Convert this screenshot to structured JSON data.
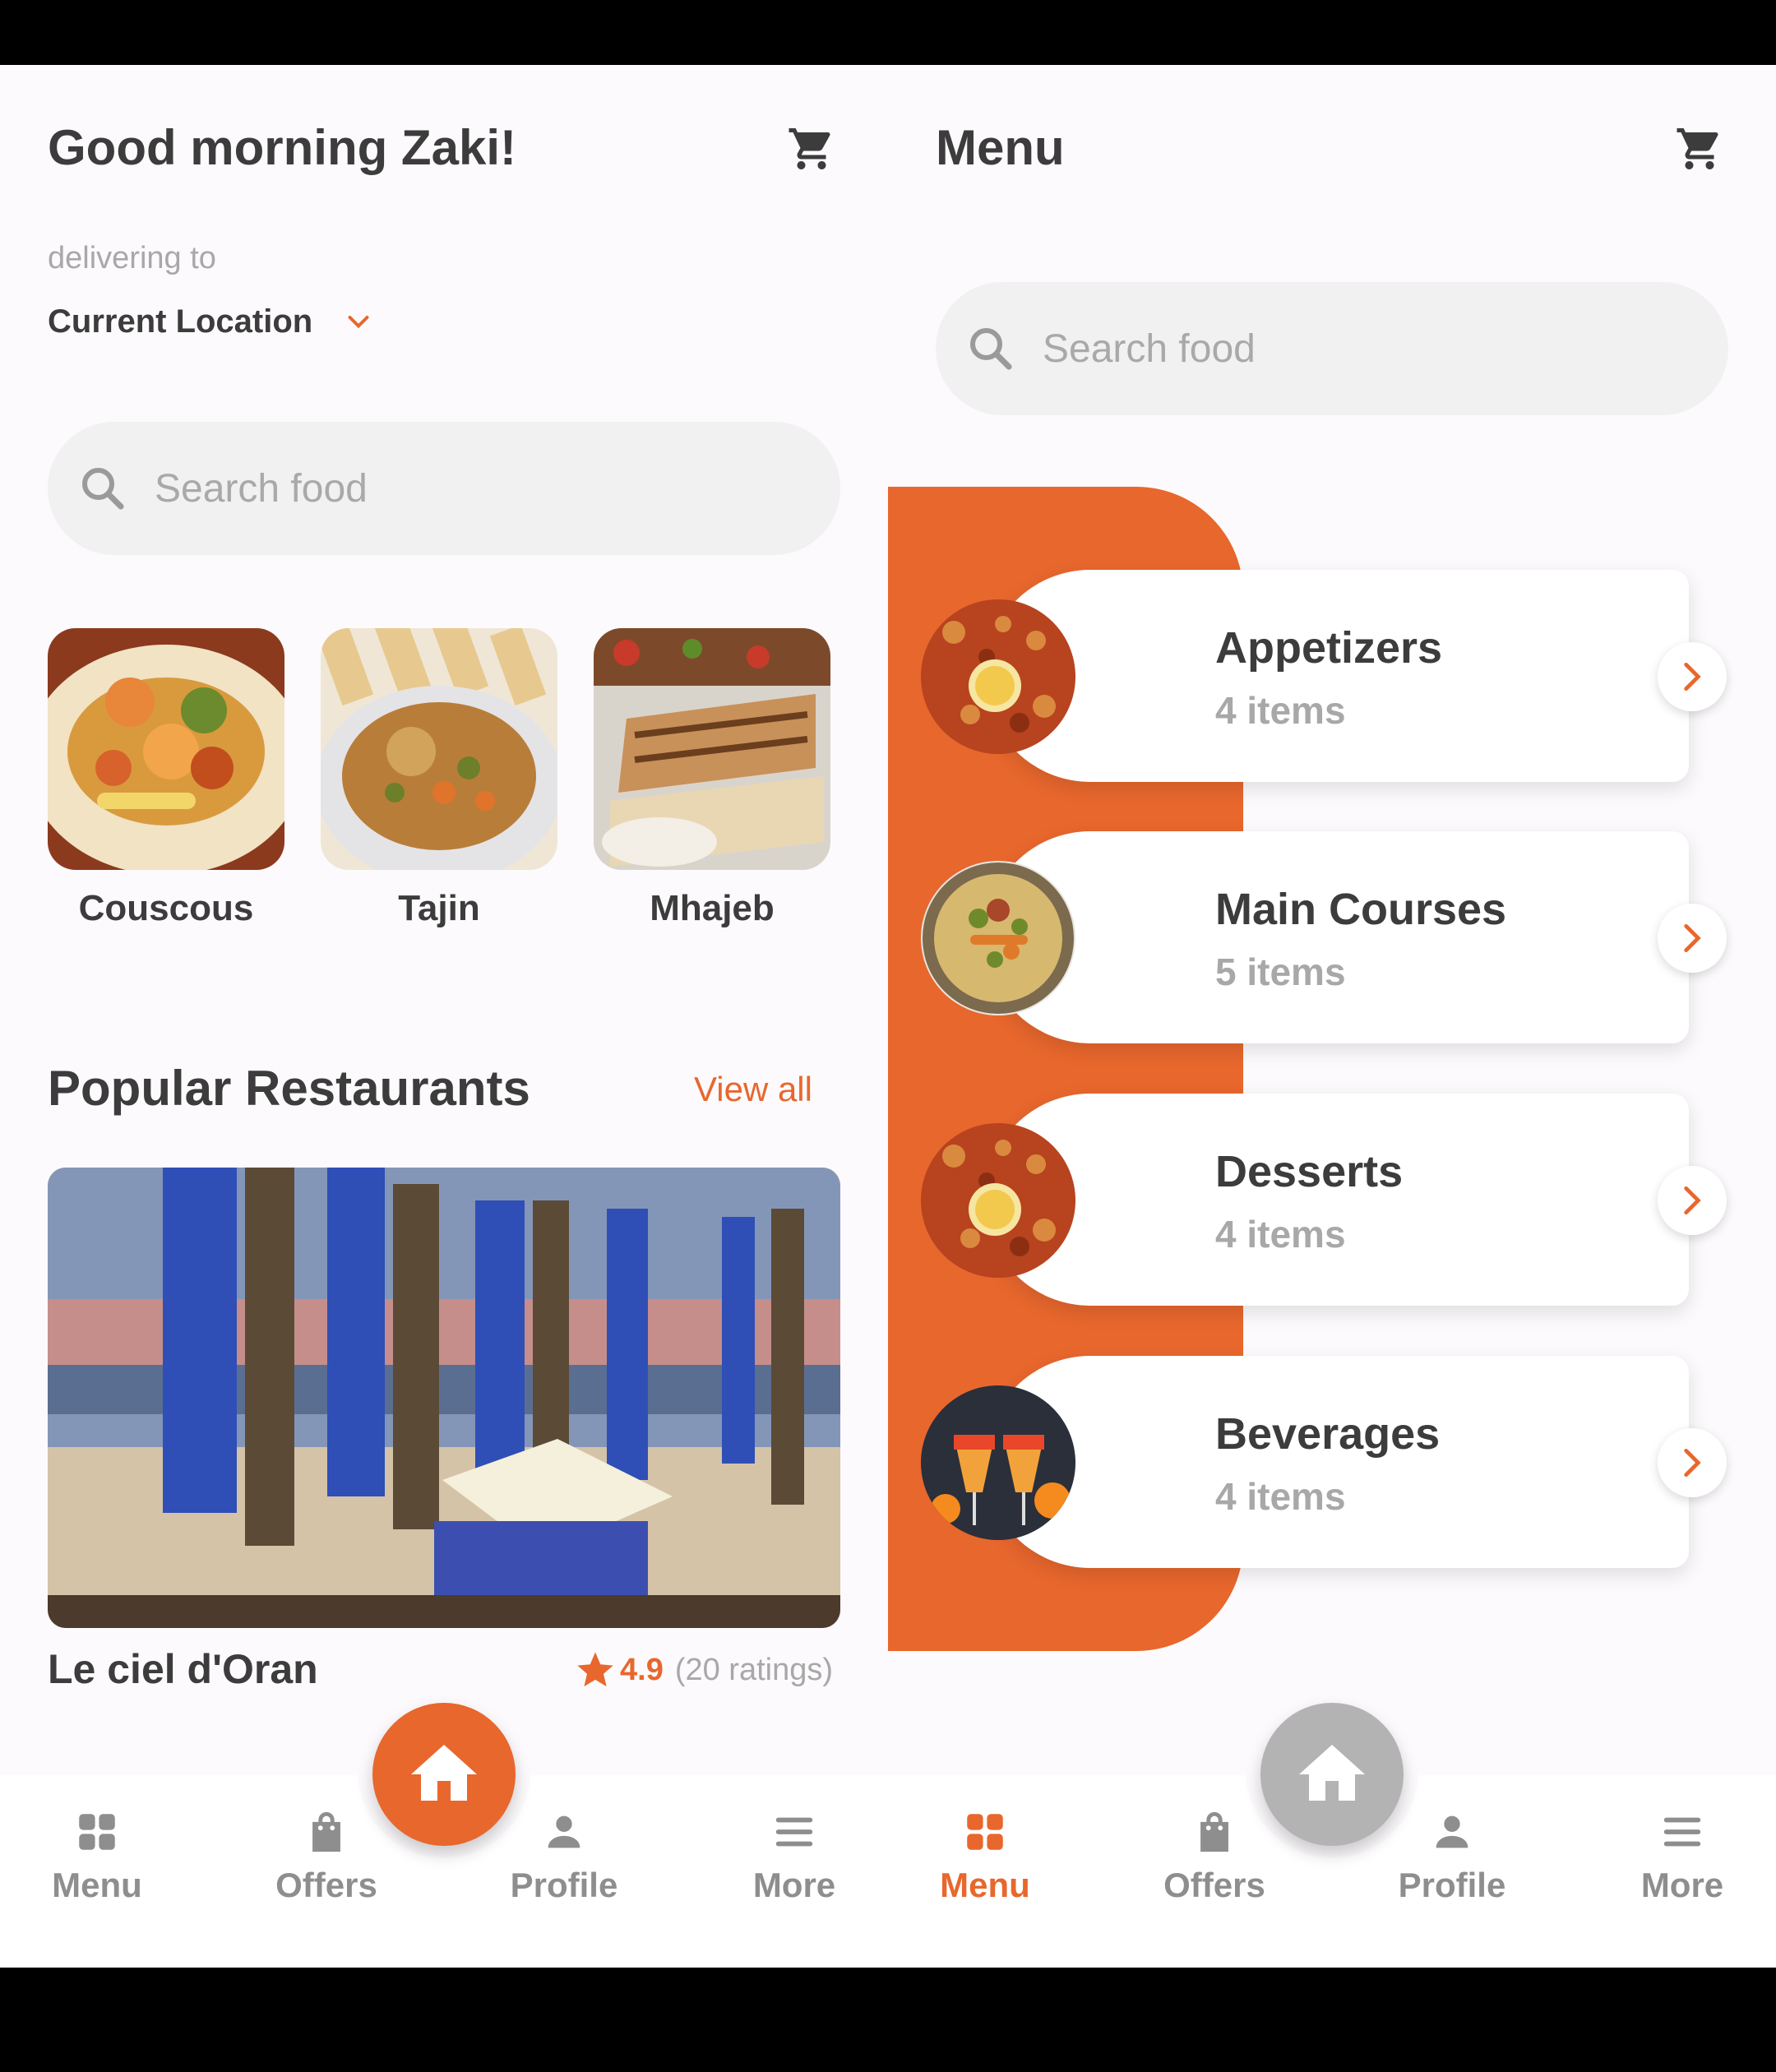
{
  "colors": {
    "accent": "#E8672D",
    "text": "#3C3C3C",
    "muted": "#A8A8A8",
    "nav_inactive": "#8E8E8E",
    "home_inactive": "#B3B3B3"
  },
  "home": {
    "greeting": "Good morning Zaki!",
    "delivering_label": "delivering to",
    "location": "Current Location",
    "search_placeholder": "Search food",
    "categories": [
      {
        "label": "Couscous",
        "icon": "couscous-photo"
      },
      {
        "label": "Tajin",
        "icon": "tajin-photo"
      },
      {
        "label": "Mhajeb",
        "icon": "mhajeb-photo"
      }
    ],
    "popular_title": "Popular Restaurants",
    "view_all": "View all",
    "restaurant": {
      "name": "Le ciel d'Oran",
      "rating": "4.9",
      "ratings_count": "(20 ratings)"
    }
  },
  "menu": {
    "title": "Menu",
    "search_placeholder": "Search food",
    "items": [
      {
        "name": "Appetizers",
        "count": "4 items"
      },
      {
        "name": "Main Courses",
        "count": "5 items"
      },
      {
        "name": "Desserts",
        "count": "4 items"
      },
      {
        "name": "Beverages",
        "count": "4 items"
      }
    ]
  },
  "nav": {
    "items": [
      {
        "label": "Menu",
        "icon": "grid-icon"
      },
      {
        "label": "Offers",
        "icon": "bag-icon"
      },
      {
        "label": "Profile",
        "icon": "person-icon"
      },
      {
        "label": "More",
        "icon": "menu-lines-icon"
      }
    ],
    "left_active": "home",
    "right_active": "Menu"
  }
}
